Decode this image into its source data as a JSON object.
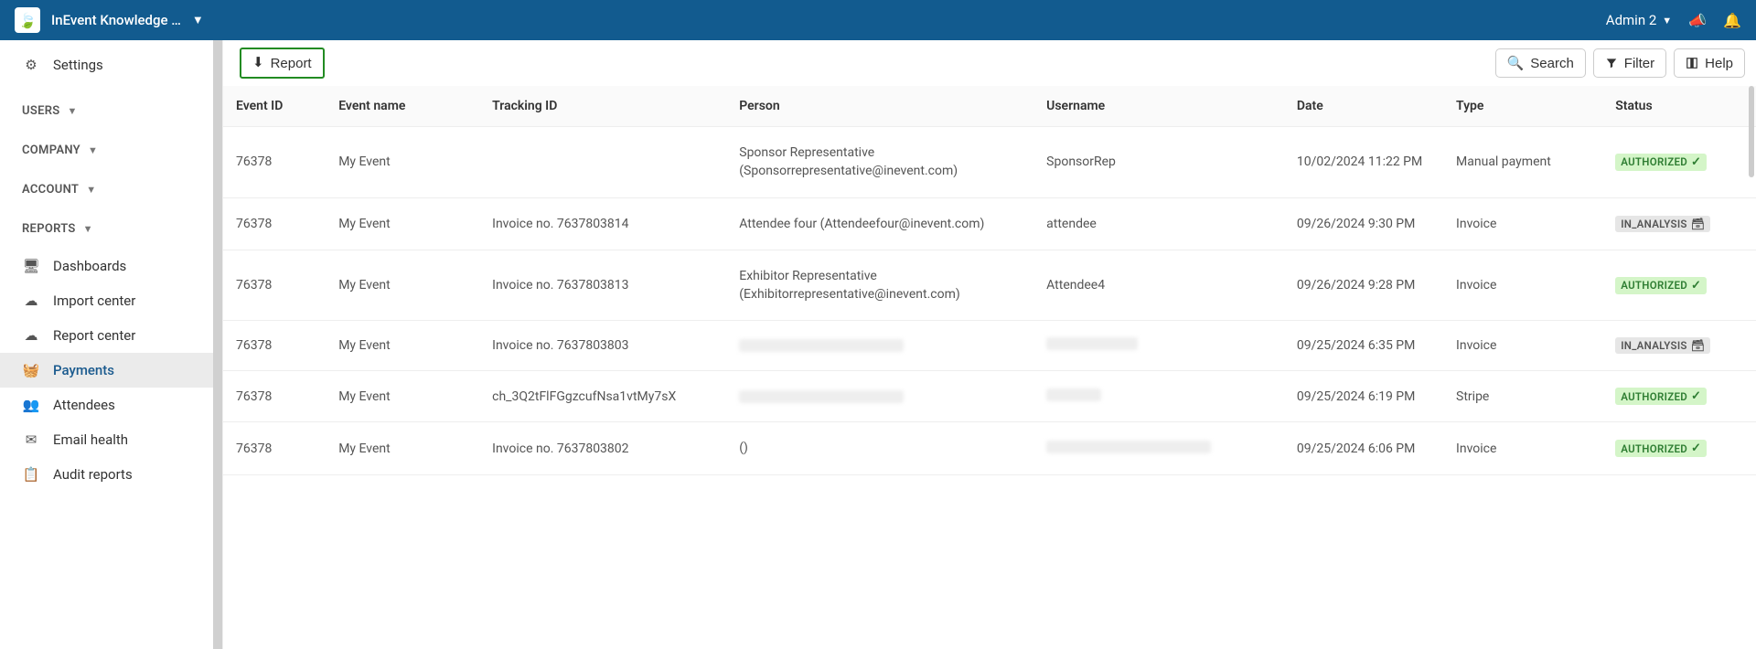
{
  "header": {
    "app_title": "InEvent Knowledge …",
    "user_label": "Admin 2"
  },
  "sidebar": {
    "settings": "Settings",
    "sections": {
      "users": "USERS",
      "company": "COMPANY",
      "account": "ACCOUNT",
      "reports": "REPORTS"
    },
    "items": {
      "dashboards": "Dashboards",
      "import_center": "Import center",
      "report_center": "Report center",
      "payments": "Payments",
      "attendees": "Attendees",
      "email_health": "Email health",
      "audit_reports": "Audit reports"
    }
  },
  "toolbar": {
    "report": "Report",
    "search": "Search",
    "filter": "Filter",
    "help": "Help"
  },
  "table": {
    "headers": {
      "event_id": "Event ID",
      "event_name": "Event name",
      "tracking_id": "Tracking ID",
      "person": "Person",
      "username": "Username",
      "date": "Date",
      "type": "Type",
      "status": "Status"
    },
    "rows": [
      {
        "event_id": "76378",
        "event_name": "My Event",
        "tracking_id": "",
        "person_line1": "Sponsor Representative",
        "person_line2": "(Sponsorrepresentative@inevent.com)",
        "username": "SponsorRep",
        "date": "10/02/2024 11:22 PM",
        "type": "Manual payment",
        "status": "AUTHORIZED",
        "status_kind": "authorized"
      },
      {
        "event_id": "76378",
        "event_name": "My Event",
        "tracking_id": "Invoice no. 7637803814",
        "person_line1": "Attendee four (Attendeefour@inevent.com)",
        "person_line2": "",
        "username": "attendee",
        "date": "09/26/2024 9:30 PM",
        "type": "Invoice",
        "status": "IN_ANALYSIS",
        "status_kind": "analysis"
      },
      {
        "event_id": "76378",
        "event_name": "My Event",
        "tracking_id": "Invoice no. 7637803813",
        "person_line1": "Exhibitor Representative",
        "person_line2": "(Exhibitorrepresentative@inevent.com)",
        "username": "Attendee4",
        "date": "09/26/2024 9:28 PM",
        "type": "Invoice",
        "status": "AUTHORIZED",
        "status_kind": "authorized"
      },
      {
        "event_id": "76378",
        "event_name": "My Event",
        "tracking_id": "Invoice no. 7637803803",
        "person_line1": "",
        "person_line2": "",
        "username": "",
        "date": "09/25/2024 6:35 PM",
        "type": "Invoice",
        "status": "IN_ANALYSIS",
        "status_kind": "analysis",
        "redact_person": true,
        "redact_user": true
      },
      {
        "event_id": "76378",
        "event_name": "My Event",
        "tracking_id": "ch_3Q2tFlFGgzcufNsa1vtMy7sX",
        "person_line1": "",
        "person_line2": "",
        "username": "",
        "date": "09/25/2024 6:19 PM",
        "type": "Stripe",
        "status": "AUTHORIZED",
        "status_kind": "authorized",
        "redact_person": true,
        "redact_user": true
      },
      {
        "event_id": "76378",
        "event_name": "My Event",
        "tracking_id": "Invoice no. 7637803802",
        "person_line1": "()",
        "person_line2": "",
        "username": "",
        "date": "09/25/2024 6:06 PM",
        "type": "Invoice",
        "status": "AUTHORIZED",
        "status_kind": "authorized",
        "redact_user": true
      }
    ]
  }
}
